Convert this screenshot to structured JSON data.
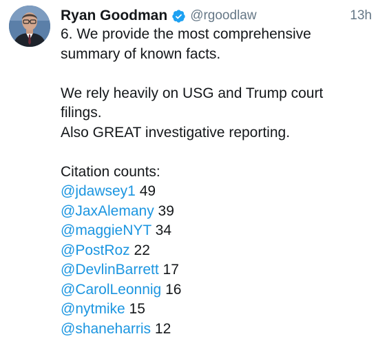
{
  "tweet": {
    "author": {
      "display_name": "Ryan Goodman",
      "handle": "@rgoodlaw",
      "verified": true,
      "avatar": "person-avatar"
    },
    "timestamp": "13h",
    "paragraphs": [
      [
        "6. We provide the most comprehensive",
        "summary of known facts."
      ],
      [
        "We rely heavily on USG and Trump court",
        "filings.",
        "Also GREAT investigative reporting."
      ]
    ],
    "citation_heading": "Citation counts:",
    "citations": [
      {
        "handle": "@jdawsey1",
        "count": "49"
      },
      {
        "handle": "@JaxAlemany",
        "count": "39"
      },
      {
        "handle": "@maggieNYT",
        "count": "34"
      },
      {
        "handle": "@PostRoz",
        "count": "22"
      },
      {
        "handle": "@DevlinBarrett",
        "count": "17"
      },
      {
        "handle": "@CarolLeonnig",
        "count": "16"
      },
      {
        "handle": "@nytmike",
        "count": "15"
      },
      {
        "handle": "@shaneharris",
        "count": "12"
      }
    ]
  },
  "colors": {
    "text": "#14171a",
    "secondary": "#657786",
    "link": "#1b95e0",
    "verified": "#1da1f2"
  }
}
